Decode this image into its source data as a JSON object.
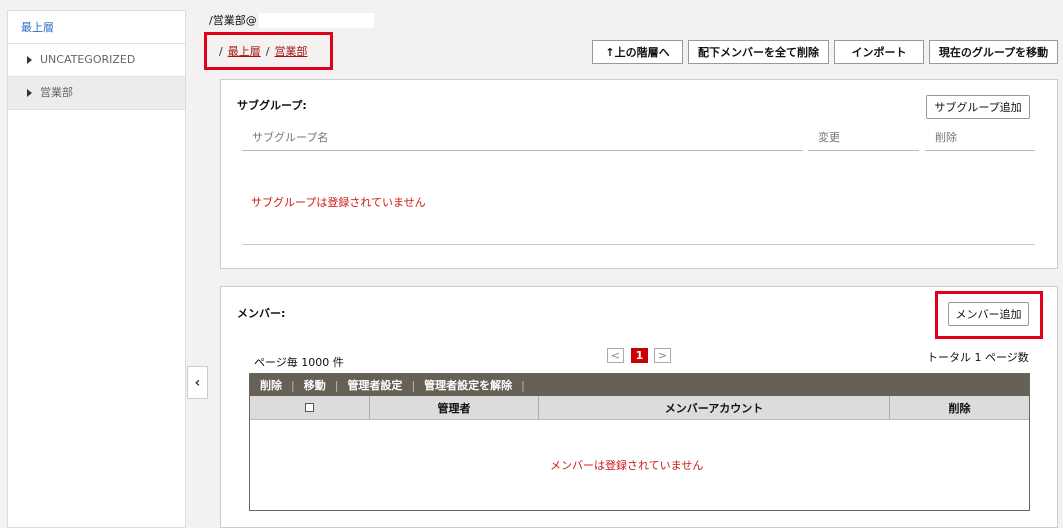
{
  "sidebar": {
    "root": "最上層",
    "items": [
      {
        "label": "UNCATEGORIZED"
      },
      {
        "label": "営業部"
      }
    ]
  },
  "path": {
    "title": "/営業部@"
  },
  "breadcrumb": {
    "sep": "/",
    "items": [
      "最上層",
      "営業部"
    ]
  },
  "toolbar": {
    "up_label": "↑上の階層へ",
    "delete_all_label": "配下メンバーを全て削除",
    "import_label": "インポート",
    "move_group_label": "現在のグループを移動"
  },
  "subgroups": {
    "title": "サブグループ:",
    "add_label": "サブグループ追加",
    "columns": [
      "サブグループ名",
      "変更",
      "削除"
    ],
    "empty": "サブグループは登録されていません"
  },
  "members": {
    "title": "メンバー:",
    "add_label": "メンバー追加",
    "per_page": "ページ毎 1000 件",
    "pagination": {
      "prev": "<",
      "current": "1",
      "next": ">"
    },
    "total": "トータル 1 ページ数",
    "actions": [
      "削除",
      "移動",
      "管理者設定",
      "管理者設定を解除"
    ],
    "columns": [
      "管理者",
      "メンバーアカウント",
      "削除"
    ],
    "empty": "メンバーは登録されていません"
  },
  "collapse": "‹"
}
